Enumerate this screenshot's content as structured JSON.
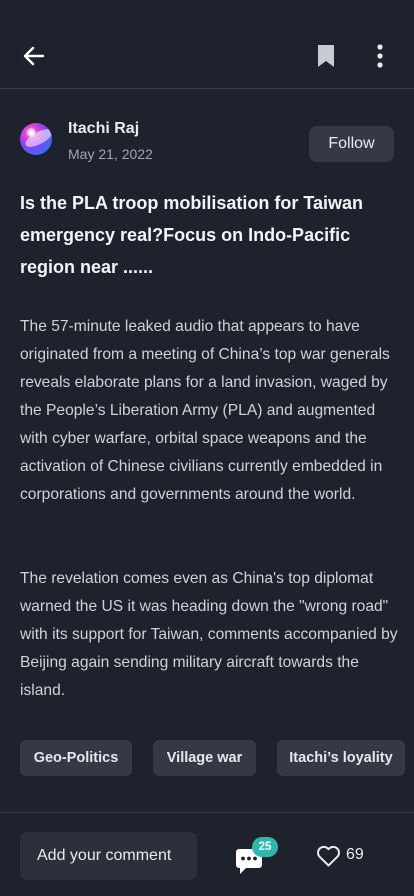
{
  "topbar": {
    "back_icon": "arrow-left-icon",
    "bookmark_icon": "bookmark-icon",
    "more_icon": "more-vertical-icon"
  },
  "author": {
    "name": "Itachi Raj",
    "date": "May 21, 2022",
    "follow_label": "Follow"
  },
  "post": {
    "title": "Is the PLA troop mobilisation for Taiwan emergency real?Focus on Indo-Pacific region near ......",
    "paragraphs": [
      "The 57-minute leaked audio that appears to have originated from a meeting of China’s top war generals reveals elaborate plans for a land invasion, waged by the People’s Liberation Army (PLA) and augmented with cyber warfare, orbital space weapons and the activation of Chinese civilians currently embedded in corporations and governments around the world.",
      "The revelation comes even as China's top diplomat warned the US it was heading down the \"wrong road\" with its support for Taiwan, comments accompanied by Beijing again sending military aircraft towards the island."
    ],
    "tags": [
      "Geo-Politics",
      "Village war",
      "Itachi’s loyality"
    ]
  },
  "bottombar": {
    "comment_placeholder": "Add your comment",
    "comment_icon": "comment-icon",
    "comment_count": "25",
    "like_icon": "heart-icon",
    "like_count": "69"
  },
  "colors": {
    "background": "#1d222c",
    "surface": "#343945",
    "badge": "#2fb7ae"
  }
}
